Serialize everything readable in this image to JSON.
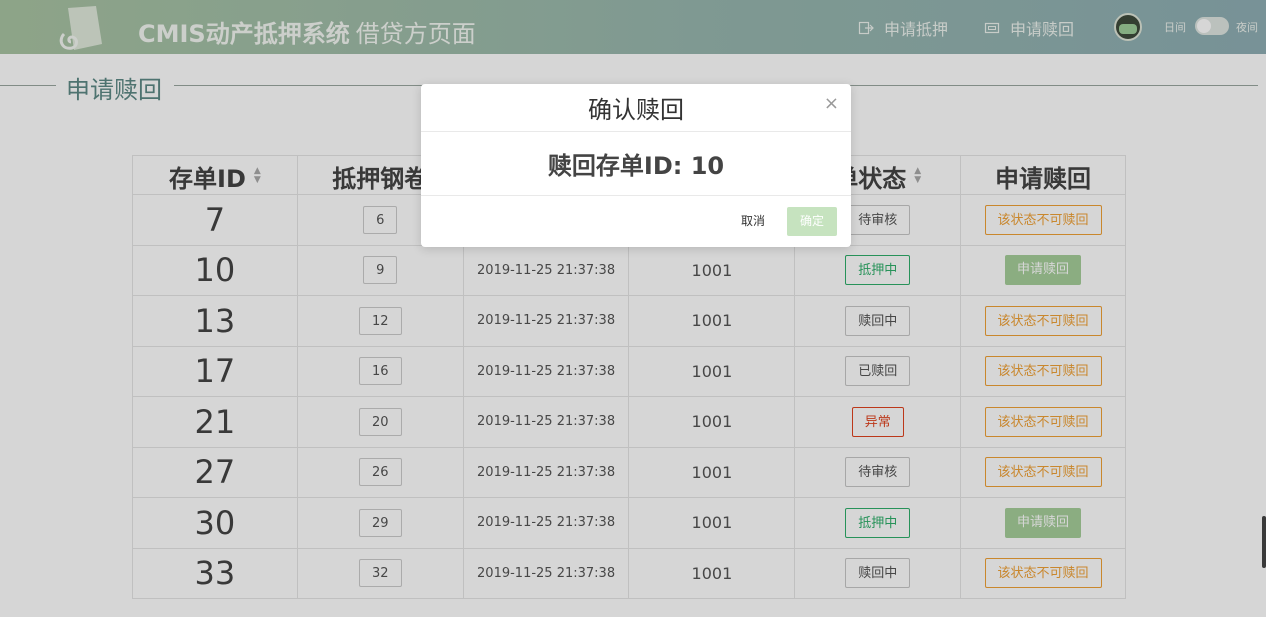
{
  "header": {
    "brand_title": "CMIS动产抵押系统",
    "brand_sub": "借贷方页面",
    "nav_apply_pledge": "申请抵押",
    "nav_apply_redeem": "申请赎回",
    "theme_day": "日间",
    "theme_night": "夜间",
    "theme_toggle_on": false
  },
  "page": {
    "section_title": "申请赎回"
  },
  "table": {
    "columns": [
      "存单ID",
      "抵押钢卷",
      "",
      "",
      "单状态",
      "申请赎回"
    ],
    "sortable": [
      true,
      false,
      false,
      false,
      true,
      false
    ],
    "rows": [
      {
        "id": "7",
        "coil": "6",
        "time": "",
        "num": "",
        "status": "待审核",
        "status_kind": "neutral",
        "action": "该状态不可赎回",
        "action_kind": "disabled"
      },
      {
        "id": "10",
        "coil": "9",
        "time": "2019-11-25 21:37:38",
        "num": "1001",
        "status": "抵押中",
        "status_kind": "pledged",
        "action": "申请赎回",
        "action_kind": "redeem"
      },
      {
        "id": "13",
        "coil": "12",
        "time": "2019-11-25 21:37:38",
        "num": "1001",
        "status": "赎回中",
        "status_kind": "neutral",
        "action": "该状态不可赎回",
        "action_kind": "disabled"
      },
      {
        "id": "17",
        "coil": "16",
        "time": "2019-11-25 21:37:38",
        "num": "1001",
        "status": "已赎回",
        "status_kind": "neutral",
        "action": "该状态不可赎回",
        "action_kind": "disabled"
      },
      {
        "id": "21",
        "coil": "20",
        "time": "2019-11-25 21:37:38",
        "num": "1001",
        "status": "异常",
        "status_kind": "abnormal",
        "action": "该状态不可赎回",
        "action_kind": "disabled"
      },
      {
        "id": "27",
        "coil": "26",
        "time": "2019-11-25 21:37:38",
        "num": "1001",
        "status": "待审核",
        "status_kind": "neutral",
        "action": "该状态不可赎回",
        "action_kind": "disabled"
      },
      {
        "id": "30",
        "coil": "29",
        "time": "2019-11-25 21:37:38",
        "num": "1001",
        "status": "抵押中",
        "status_kind": "pledged",
        "action": "申请赎回",
        "action_kind": "redeem"
      },
      {
        "id": "33",
        "coil": "32",
        "time": "2019-11-25 21:37:38",
        "num": "1001",
        "status": "赎回中",
        "status_kind": "neutral",
        "action": "该状态不可赎回",
        "action_kind": "disabled"
      }
    ]
  },
  "modal": {
    "title": "确认赎回",
    "body": "赎回存单ID: 10",
    "cancel_label": "取消",
    "ok_label": "确定",
    "close_glyph": "×"
  },
  "colors": {
    "header_gradient_start": "#a9c4a3",
    "header_gradient_end": "#8fafb4",
    "section_title": "#5e8a86",
    "pledged": "#2faf6a",
    "abnormal": "#e0431f",
    "disabled_action": "#f0a136",
    "redeem_button": "#a6cf9a",
    "ok_button": "#c6e3bf"
  },
  "icons": {
    "logo": "scroll-logo-icon",
    "nav_apply_pledge": "logout-arrow-icon",
    "nav_apply_redeem": "ticket-icon",
    "avatar": "avatar-icon",
    "close": "close-icon",
    "sort": "sort-icon"
  }
}
